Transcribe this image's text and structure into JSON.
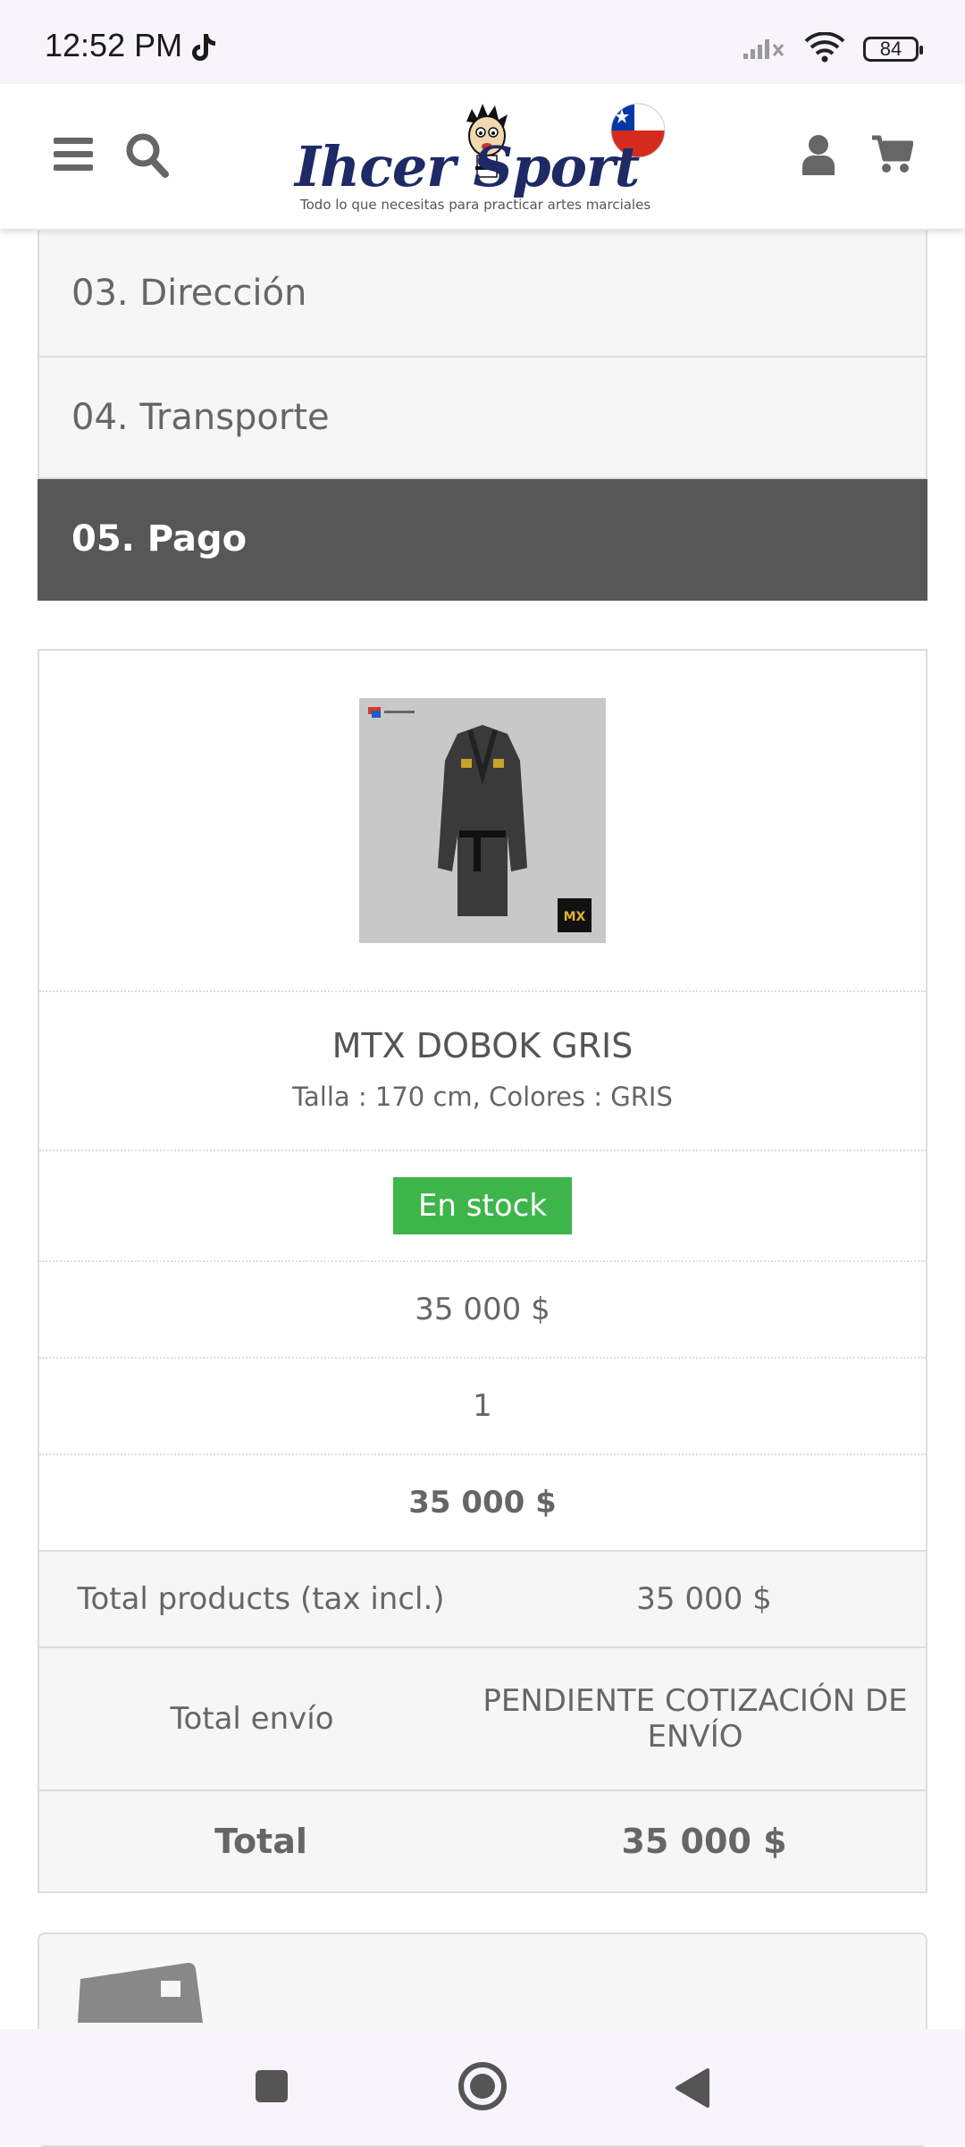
{
  "status": {
    "time": "12:52 PM",
    "battery": "84"
  },
  "header": {
    "logo_text": "Ihcer Sport",
    "logo_tagline": "Todo lo que necesitas para practicar artes marciales"
  },
  "steps": [
    {
      "label": "03. Dirección",
      "active": false
    },
    {
      "label": "04. Transporte",
      "active": false
    },
    {
      "label": "05. Pago",
      "active": true
    }
  ],
  "product": {
    "name": "MTX DOBOK GRIS",
    "attributes": "Talla : 170 cm, Colores : GRIS",
    "stock_label": "En stock",
    "unit_price": "35 000 $",
    "quantity": "1",
    "line_total": "35 000 $"
  },
  "totals": {
    "products_label": "Total products (tax incl.)",
    "products_value": "35 000 $",
    "shipping_label": "Total envío",
    "shipping_value": "PENDIENTE COTIZACIÓN DE ENVÍO",
    "total_label": "Total",
    "total_value": "35 000 $"
  },
  "colors": {
    "active_step": "#575757",
    "stock_badge": "#3eb54b",
    "logo_blue": "#1e2a66"
  }
}
